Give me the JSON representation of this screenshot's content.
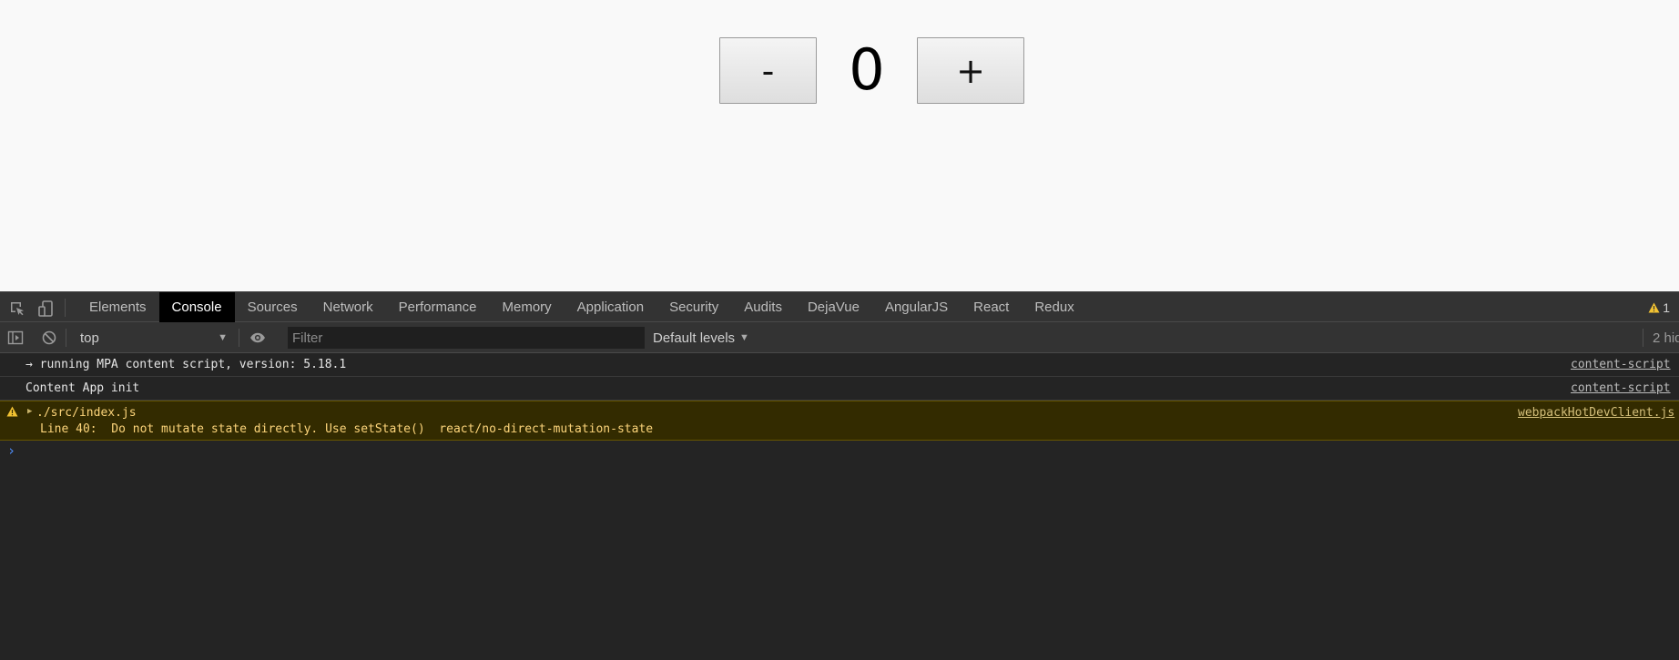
{
  "counter": {
    "decrement_label": "-",
    "value": "0",
    "increment_label": "+"
  },
  "devtools": {
    "tabs": [
      {
        "label": "Elements"
      },
      {
        "label": "Console",
        "active": true
      },
      {
        "label": "Sources"
      },
      {
        "label": "Network"
      },
      {
        "label": "Performance"
      },
      {
        "label": "Memory"
      },
      {
        "label": "Application"
      },
      {
        "label": "Security"
      },
      {
        "label": "Audits"
      },
      {
        "label": "DejaVue"
      },
      {
        "label": "AngularJS"
      },
      {
        "label": "React"
      },
      {
        "label": "Redux"
      }
    ],
    "warning_count": "1",
    "toolbar": {
      "context": "top",
      "filter_placeholder": "Filter",
      "levels_label": "Default levels",
      "hidden_text": "2 hid"
    },
    "messages": [
      {
        "text": "→ running MPA content script, version: 5.18.1",
        "source": "content-script"
      },
      {
        "text": "Content App init",
        "source": "content-script"
      },
      {
        "level": "warning",
        "text_line1": "./src/index.js",
        "text_line2": "Line 40:  Do not mutate state directly. Use setState()  react/no-direct-mutation-state",
        "source": "webpackHotDevClient.js"
      }
    ],
    "prompt_symbol": "›"
  },
  "colors": {
    "viewport_bg": "#f9f9f9",
    "devtools_bg": "#242424",
    "toolbar_bg": "#333333",
    "active_tab_bg": "#000000",
    "warning_bg": "#332b00",
    "warning_text": "#fcd47a",
    "prompt_accent": "#4e8cf7"
  },
  "icons": {
    "inspect": "inspect-element-icon",
    "device": "device-toolbar-icon",
    "sidebar": "show-sidebar-icon",
    "clear": "clear-console-icon",
    "eye": "live-expression-eye-icon",
    "warning": "warning-triangle-icon"
  }
}
